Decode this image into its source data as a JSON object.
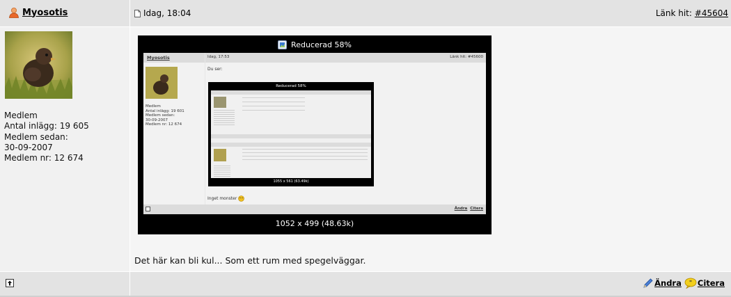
{
  "post": {
    "author": "Myosotis",
    "date": "Idag, 18:04",
    "link_label": "Länk hit:",
    "link_id": "#45604",
    "user_info": {
      "role": "Medlem",
      "posts": "Antal inlägg: 19 605",
      "member_since_label": "Medlem sedan:",
      "member_since": "30-09-2007",
      "member_nr": "Medlem nr: 12 674"
    },
    "image": {
      "title": "Reducerad 58%",
      "caption": "1052 x 499 (48.63k)"
    },
    "text": "Det här kan bli kul... Som ett rum med spegelväggar.",
    "actions": {
      "edit": "Ändra",
      "quote": "Citera"
    }
  },
  "inner": {
    "author": "Myosotis",
    "date": "Idag, 17:53",
    "link": "Länk hit: #45600",
    "user_info": [
      "Medlem",
      "Antal inlägg: 19 601",
      "Medlem sedan:",
      "30-09-2007",
      "Medlem nr: 12 674"
    ],
    "text": "Du ser:",
    "image_title": "Reducerad 58%",
    "image_caption": "1055 x 561 (63.49k)",
    "bottom_text": "Inget monster",
    "edit": "Ändra",
    "quote": "Citera"
  },
  "colors": {
    "header_bg": "#e3e3e3",
    "left_bg": "#f1f1f1",
    "right_bg": "#f5f5f5"
  }
}
